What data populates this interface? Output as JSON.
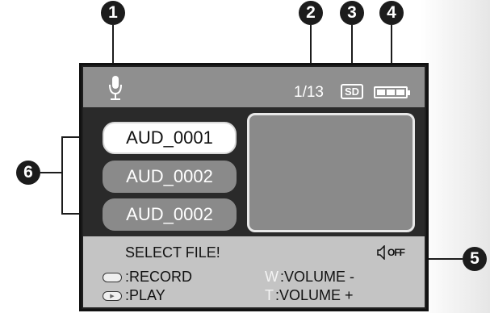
{
  "callouts": [
    "1",
    "2",
    "3",
    "4",
    "5",
    "6"
  ],
  "screen": {
    "topbar": {
      "mic_icon": "microphone-icon",
      "counter": "1/13",
      "sd_label": "SD",
      "battery_icon": "battery-full-icon"
    },
    "files": [
      {
        "name": "AUD_0001",
        "selected": true
      },
      {
        "name": "AUD_0002",
        "selected": false
      },
      {
        "name": "AUD_0002",
        "selected": false
      }
    ],
    "bottombar": {
      "status": "SELECT FILE!",
      "speaker_off_label": "OFF",
      "legend": {
        "record": ":RECORD",
        "play": ":PLAY",
        "volume_down_key": "W",
        "volume_down": ":VOLUME -",
        "volume_up_key": "T",
        "volume_up": ":VOLUME +"
      }
    }
  },
  "colors": {
    "screen_bg": "#1f1f1f",
    "topbar": "#8f8f8f",
    "bottombar": "#c4c4c4",
    "file_item": "#8a8a8a",
    "selected_item": "#ffffff",
    "callout": "#1c1c1c"
  }
}
